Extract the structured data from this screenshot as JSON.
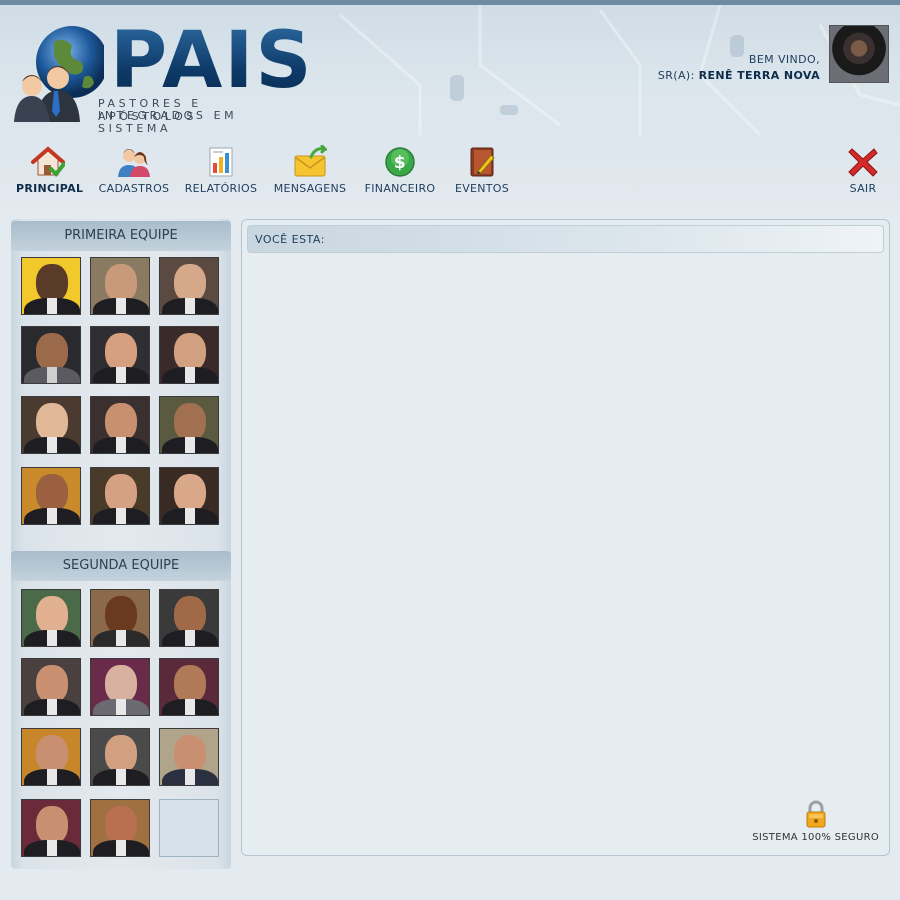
{
  "header": {
    "logo_title": "PAIS",
    "logo_subtitle_1": "PASTORES E APÓSTOLOS",
    "logo_subtitle_2": "INTEGRADOS EM SISTEMA",
    "welcome_line": "BEM VINDO,",
    "user_prefix": "SR(A):",
    "user_name": "RENÊ TERRA NOVA"
  },
  "menu": {
    "items": [
      {
        "label": "PRINCIPAL",
        "icon": "home-icon",
        "active": true
      },
      {
        "label": "CADASTROS",
        "icon": "users-icon"
      },
      {
        "label": "RELATÓRIOS",
        "icon": "report-chart-icon"
      },
      {
        "label": "MENSAGENS",
        "icon": "envelope-icon"
      },
      {
        "label": "FINANCEIRO",
        "icon": "dollar-coin-icon"
      },
      {
        "label": "EVENTOS",
        "icon": "notebook-pencil-icon"
      }
    ],
    "logout_label": "SAIR",
    "logout_icon": "red-x-icon"
  },
  "sidebar": {
    "team1_title": "PRIMEIRA EQUIPE",
    "team2_title": "SEGUNDA EQUIPE"
  },
  "main": {
    "breadcrumb_label": "VOCÊ ESTA:",
    "secure_text": "SISTEMA 100% SEGURO"
  },
  "colors": {
    "brand_dark_blue": "#0e3a68",
    "menu_text": "#1f3d5c",
    "panel_border": "#b4c4d1"
  }
}
